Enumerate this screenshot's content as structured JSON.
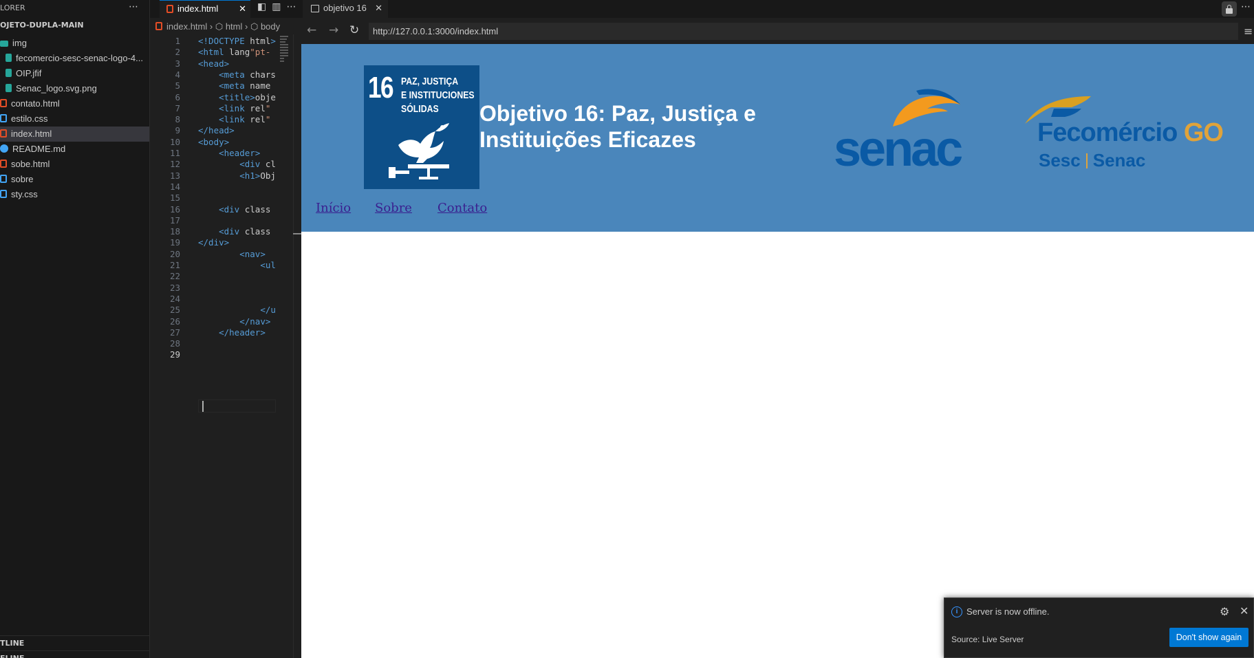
{
  "explorer": {
    "title": "LORER",
    "project": "OJETO-DUPLA-MAIN",
    "items": [
      {
        "label": "img",
        "icon": "folder-icon"
      },
      {
        "label": "fecomercio-sesc-senac-logo-4...",
        "icon": "image-file-icon"
      },
      {
        "label": "OIP.jfif",
        "icon": "image-file-icon"
      },
      {
        "label": "Senac_logo.svg.png",
        "icon": "image-file-icon"
      },
      {
        "label": "contato.html",
        "icon": "html-file-icon"
      },
      {
        "label": "estilo.css",
        "icon": "css-file-icon"
      },
      {
        "label": "index.html",
        "icon": "html-file-icon"
      },
      {
        "label": "README.md",
        "icon": "info-file-icon"
      },
      {
        "label": "sobe.html",
        "icon": "html-file-icon"
      },
      {
        "label": "sobre",
        "icon": "file-icon"
      },
      {
        "label": "sty.css",
        "icon": "css-file-icon"
      }
    ],
    "outline": "TLINE",
    "timeline": "ELINE"
  },
  "editor": {
    "tab_label": "index.html",
    "breadcrumb": [
      "index.html",
      "html",
      "body"
    ],
    "lines": [
      {
        "n": "1",
        "code": "<!DOCTYPE html>"
      },
      {
        "n": "2",
        "code": "<html lang=\"pt-"
      },
      {
        "n": "3",
        "code": "<head>"
      },
      {
        "n": "4",
        "code": "    <meta chars"
      },
      {
        "n": "5",
        "code": "    <meta name="
      },
      {
        "n": "6",
        "code": "    <title>obje"
      },
      {
        "n": "7",
        "code": "    <link rel=\""
      },
      {
        "n": "8",
        "code": "    <link rel=\""
      },
      {
        "n": "9",
        "code": "</head>"
      },
      {
        "n": "10",
        "code": "<body>"
      },
      {
        "n": "11",
        "code": "    <header>"
      },
      {
        "n": "12",
        "code": "        <div cl"
      },
      {
        "n": "13",
        "code": "        <h1>Obj"
      },
      {
        "n": "14",
        "code": ""
      },
      {
        "n": "15",
        "code": ""
      },
      {
        "n": "16",
        "code": "    <div class="
      },
      {
        "n": "17",
        "code": ""
      },
      {
        "n": "18",
        "code": "    <div class="
      },
      {
        "n": "19",
        "code": "</div>"
      },
      {
        "n": "20",
        "code": "        <nav>"
      },
      {
        "n": "21",
        "code": "            <ul"
      },
      {
        "n": "22",
        "code": ""
      },
      {
        "n": "23",
        "code": ""
      },
      {
        "n": "24",
        "code": ""
      },
      {
        "n": "25",
        "code": "            </u"
      },
      {
        "n": "26",
        "code": "        </nav>"
      },
      {
        "n": "27",
        "code": "    </header>"
      },
      {
        "n": "28",
        "code": ""
      },
      {
        "n": "29",
        "code": ""
      }
    ]
  },
  "browser": {
    "tab_label": "objetivo 16",
    "url": "http://127.0.0.1:3000/index.html",
    "page": {
      "sdg_number": "16",
      "sdg_text": [
        "PAZ, JUSTIÇA",
        "E INSTITUCIONES",
        "SÓLIDAS"
      ],
      "title": "Objetivo 16: Paz, Justiça e Instituições Eficazes",
      "senac_logo_text": "senac",
      "fecomercio_text": "Fecomércio",
      "fecomercio_go": "GO",
      "fecomercio_sub1": "Sesc",
      "fecomercio_sub2": "Senac",
      "nav": [
        "Início",
        "Sobre",
        "Contato"
      ]
    }
  },
  "notification": {
    "message": "Server is now offline.",
    "source": "Source: Live Server",
    "button": "Don't show again"
  },
  "colors": {
    "header_bg": "#4a86bb",
    "sdg_blue": "#0d4f88",
    "senac_blue": "#0a5aa5",
    "senac_orange": "#f39a1e",
    "accent_button": "#0078d4"
  }
}
